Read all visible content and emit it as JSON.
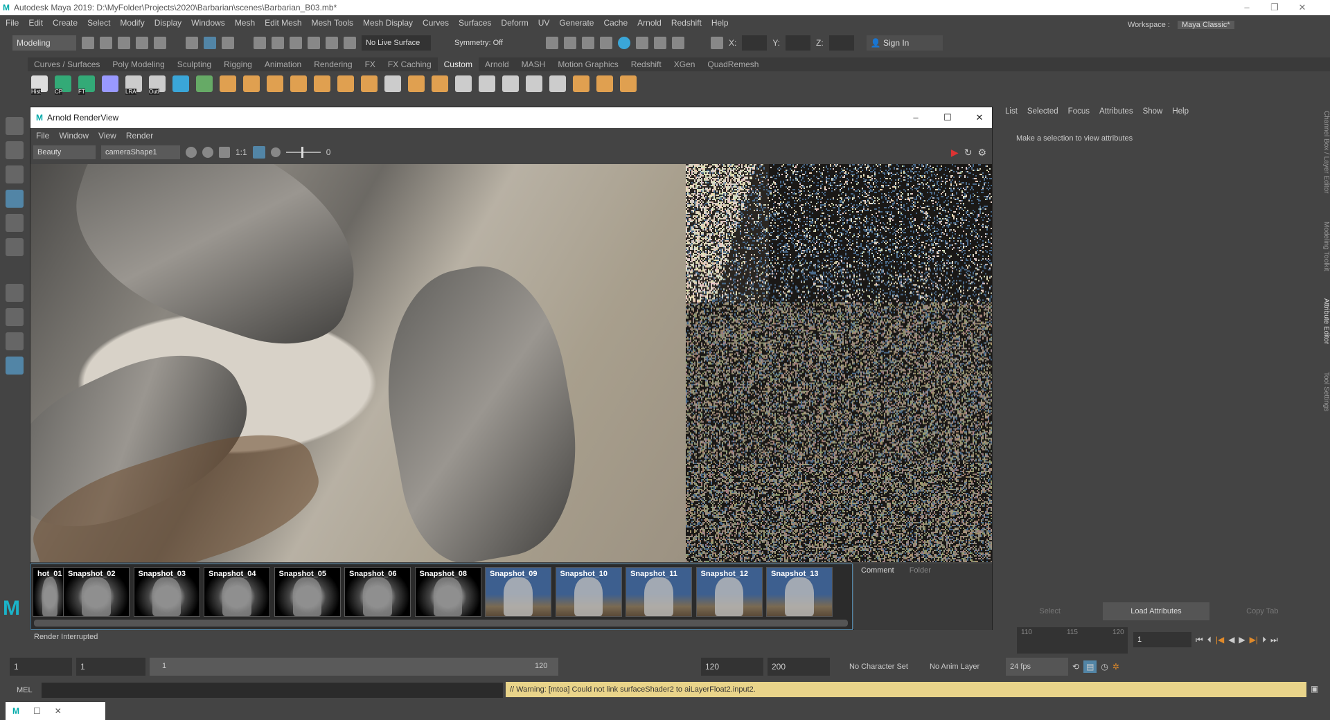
{
  "titlebar": {
    "logo": "M",
    "title": "Autodesk Maya 2019: D:\\MyFolder\\Projects\\2020\\Barbarian\\scenes\\Barbarian_B03.mb*",
    "controls": [
      "–",
      "❐",
      "✕"
    ]
  },
  "menubar": [
    "File",
    "Edit",
    "Create",
    "Select",
    "Modify",
    "Display",
    "Windows",
    "Mesh",
    "Edit Mesh",
    "Mesh Tools",
    "Mesh Display",
    "Curves",
    "Surfaces",
    "Deform",
    "UV",
    "Generate",
    "Cache",
    "Arnold",
    "Redshift",
    "Help"
  ],
  "statusline": {
    "mode": "Modeling",
    "live_surface": "No Live Surface",
    "symmetry": "Symmetry: Off",
    "x_label": "X:",
    "y_label": "Y:",
    "z_label": "Z:",
    "sign_in": "Sign In",
    "workspace_label": "Workspace :",
    "workspace": "Maya Classic*"
  },
  "shelf": {
    "tabs": [
      "Curves / Surfaces",
      "Poly Modeling",
      "Sculpting",
      "Rigging",
      "Animation",
      "Rendering",
      "FX",
      "FX Caching",
      "Custom",
      "Arnold",
      "MASH",
      "Motion Graphics",
      "Redshift",
      "XGen",
      "QuadRemesh"
    ],
    "active": "Custom",
    "icon_labels": [
      "Hist",
      "CP",
      "FT",
      "",
      "LRA",
      "Outl"
    ]
  },
  "renderview": {
    "title": "Arnold RenderView",
    "menu": [
      "File",
      "Window",
      "View",
      "Render"
    ],
    "aov": "Beauty",
    "camera": "cameraShape1",
    "ratio": "1:1",
    "exposure": "0",
    "snapshots": [
      "hot_01",
      "Snapshot_02",
      "Snapshot_03",
      "Snapshot_04",
      "Snapshot_05",
      "Snapshot_06",
      "Snapshot_08",
      "Snapshot_09",
      "Snapshot_10",
      "Snapshot_11",
      "Snapshot_12",
      "Snapshot_13"
    ],
    "comment_tabs": [
      "Comment",
      "Folder"
    ],
    "status": "Render Interrupted"
  },
  "attribute_editor": {
    "menu": [
      "List",
      "Selected",
      "Focus",
      "Attributes",
      "Show",
      "Help"
    ],
    "message": "Make a selection to view attributes",
    "buttons": [
      "Select",
      "Load Attributes",
      "Copy Tab"
    ],
    "side_tabs": [
      "Channel Box / Layer Editor",
      "Modeling Toolkit",
      "Attribute Editor",
      "Tool Settings"
    ]
  },
  "timeline": {
    "ticks": [
      "110",
      "115",
      "120"
    ],
    "current_frame": "1"
  },
  "range": {
    "start": "1",
    "playback_start": "1",
    "slider_start": "1",
    "slider_end": "120",
    "playback_end": "120",
    "end": "200",
    "character_set": "No Character Set",
    "anim_layer": "No Anim Layer",
    "fps": "24 fps"
  },
  "mel": {
    "label": "MEL",
    "warning": "// Warning: [mtoa] Could not link surfaceShader2 to aiLayerFloat2.input2."
  },
  "colors": {
    "accent": "#5285a6",
    "warning": "#e9d48a"
  }
}
